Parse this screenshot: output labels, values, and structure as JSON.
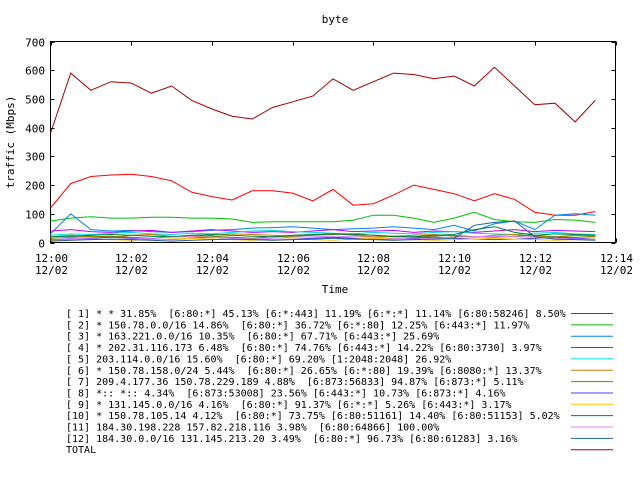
{
  "chart_data": {
    "type": "line",
    "title": "byte",
    "xlabel": "Time",
    "ylabel": "traffic (Mbps)",
    "ylim": [
      0,
      700
    ],
    "yticks": [
      0,
      100,
      200,
      300,
      400,
      500,
      600,
      700
    ],
    "xlim": [
      "12:00",
      "12:14"
    ],
    "xticks": [
      {
        "time": "12:00",
        "date": "12/02"
      },
      {
        "time": "12:02",
        "date": "12/02"
      },
      {
        "time": "12:04",
        "date": "12/02"
      },
      {
        "time": "12:06",
        "date": "12/02"
      },
      {
        "time": "12:08",
        "date": "12/02"
      },
      {
        "time": "12:10",
        "date": "12/02"
      },
      {
        "time": "12:12",
        "date": "12/02"
      },
      {
        "time": "12:14",
        "date": "12/02"
      }
    ],
    "grid": false,
    "legend_position": "bottom",
    "x": [
      "12:00:00",
      "12:00:30",
      "12:01:00",
      "12:01:30",
      "12:02:00",
      "12:02:30",
      "12:03:00",
      "12:03:30",
      "12:04:00",
      "12:04:30",
      "12:05:00",
      "12:05:30",
      "12:06:00",
      "12:06:30",
      "12:07:00",
      "12:07:30",
      "12:08:00",
      "12:08:30",
      "12:09:00",
      "12:09:30",
      "12:10:00",
      "12:10:30",
      "12:11:00",
      "12:11:30",
      "12:12:00",
      "12:12:30",
      "12:13:00",
      "12:13:30"
    ],
    "series": [
      {
        "name": "[ 1] * * 31.85%  [6:80:*] 45.13% [6:*:443] 11.19% [6:*:*] 11.14% [6:80:58246] 8.50%",
        "color": "#ff0000",
        "values": [
          120,
          205,
          230,
          235,
          238,
          230,
          215,
          175,
          160,
          148,
          180,
          180,
          172,
          145,
          185,
          130,
          135,
          165,
          200,
          185,
          170,
          145,
          170,
          150,
          105,
          95,
          95,
          108
        ]
      },
      {
        "name": "[ 2] * 150.78.0.0/16 14.86%  [6:80:*] 36.72% [6:*:80] 12.25% [6:443:*] 11.97%",
        "color": "#00c000",
        "values": [
          75,
          85,
          90,
          85,
          85,
          88,
          88,
          85,
          85,
          82,
          70,
          72,
          72,
          72,
          72,
          78,
          95,
          95,
          85,
          70,
          85,
          105,
          80,
          72,
          70,
          80,
          78,
          70
        ]
      },
      {
        "name": "[ 3] * 163.221.0.0/16 10.35%  [6:80:*] 67.71% [6:443:*] 25.69%",
        "color": "#0080ff",
        "values": [
          30,
          100,
          45,
          40,
          42,
          38,
          35,
          38,
          42,
          45,
          50,
          52,
          55,
          50,
          45,
          48,
          50,
          55,
          50,
          45,
          60,
          40,
          65,
          75,
          45,
          95,
          100,
          95
        ]
      },
      {
        "name": "[ 4] * 202.31.116.173 6.48%  [6:80:*] 74.76% [6:443:*] 14.22% [6:80:3730] 3.97%",
        "color": "#c000ff",
        "values": [
          40,
          45,
          38,
          35,
          40,
          42,
          35,
          40,
          45,
          40,
          35,
          38,
          35,
          40,
          45,
          38,
          40,
          42,
          35,
          40,
          38,
          35,
          40,
          45,
          38,
          42,
          40,
          38
        ]
      },
      {
        "name": "[ 5] 203.114.0.0/16 15.60%  [6:80:*] 69.20% [1:2048:2048] 26.92%",
        "color": "#00e0e0",
        "values": [
          25,
          30,
          28,
          32,
          35,
          30,
          28,
          32,
          30,
          35,
          40,
          42,
          38,
          35,
          32,
          30,
          35,
          32,
          30,
          35,
          38,
          32,
          30,
          28,
          32,
          35,
          30,
          28
        ]
      },
      {
        "name": "[ 6] * 150.78.158.0/24 5.44%  [6:80:*] 26.65% [6:*:80] 19.39% [6:8080:*] 13.37%",
        "color": "#c08000",
        "values": [
          20,
          25,
          22,
          18,
          25,
          28,
          22,
          20,
          25,
          30,
          28,
          25,
          22,
          28,
          30,
          25,
          20,
          22,
          25,
          28,
          22,
          18,
          25,
          28,
          22,
          20,
          25,
          22
        ]
      },
      {
        "name": "[ 7] 209.4.177.36 150.78.229.189 4.88%  [6:873:56833] 94.87% [6:873:*] 5.11%",
        "color": "#808000",
        "values": [
          15,
          18,
          20,
          22,
          18,
          15,
          20,
          25,
          22,
          18,
          15,
          20,
          22,
          25,
          28,
          30,
          25,
          20,
          18,
          22,
          25,
          20,
          18,
          22,
          25,
          20,
          18,
          20
        ]
      },
      {
        "name": "[ 8] *:: *:: 4.34%  [6:873:53008] 23.56% [6:443:*] 10.73% [6:873:*] 4.16%",
        "color": "#4040ff",
        "values": [
          10,
          12,
          15,
          18,
          15,
          12,
          10,
          15,
          18,
          15,
          12,
          10,
          12,
          15,
          18,
          15,
          12,
          10,
          15,
          18,
          15,
          12,
          10,
          12,
          15,
          18,
          15,
          12
        ]
      },
      {
        "name": "[ 9] * 131.145.0.0/16 4.16%  [6:80:*] 91.37% [6:*:*] 5.26% [6:443:*] 3.17%",
        "color": "#ffc000",
        "values": [
          8,
          10,
          12,
          10,
          8,
          10,
          12,
          15,
          12,
          10,
          8,
          10,
          12,
          10,
          8,
          12,
          15,
          12,
          10,
          8,
          10,
          12,
          15,
          12,
          10,
          8,
          10,
          12
        ]
      },
      {
        "name": "[10] * 150.78.105.14 4.12%  [6:80:*] 73.75% [6:80:51161] 14.40% [6:80:51153] 5.02%",
        "color": "#008040",
        "values": [
          20,
          22,
          25,
          28,
          25,
          22,
          20,
          25,
          28,
          25,
          22,
          20,
          25,
          28,
          30,
          28,
          25,
          22,
          20,
          25,
          28,
          45,
          55,
          35,
          25,
          30,
          28,
          25
        ]
      },
      {
        "name": "[11] 184.30.198.228 157.82.218.116 3.98%  [6:80:64866] 100.00%",
        "color": "#e080ff",
        "values": [
          18,
          15,
          12,
          10,
          12,
          15,
          18,
          20,
          18,
          15,
          12,
          15,
          18,
          20,
          22,
          20,
          18,
          15,
          12,
          15,
          18,
          20,
          22,
          20,
          18,
          15,
          12,
          10
        ]
      },
      {
        "name": "[12] 184.30.0.0/16 131.145.213.20 3.49%  [6:80:*] 96.73% [6:80:61283] 3.16%",
        "color": "#2060a0",
        "values": [
          5,
          8,
          10,
          12,
          10,
          8,
          5,
          8,
          10,
          12,
          10,
          8,
          10,
          12,
          15,
          12,
          10,
          8,
          10,
          12,
          15,
          60,
          70,
          75,
          20,
          12,
          10,
          8
        ]
      },
      {
        "name": "TOTAL",
        "color": "#a00000",
        "values": [
          380,
          590,
          530,
          560,
          555,
          520,
          545,
          495,
          465,
          440,
          430,
          470,
          490,
          510,
          570,
          530,
          560,
          590,
          585,
          570,
          580,
          545,
          610,
          545,
          480,
          485,
          420,
          495
        ]
      }
    ]
  }
}
